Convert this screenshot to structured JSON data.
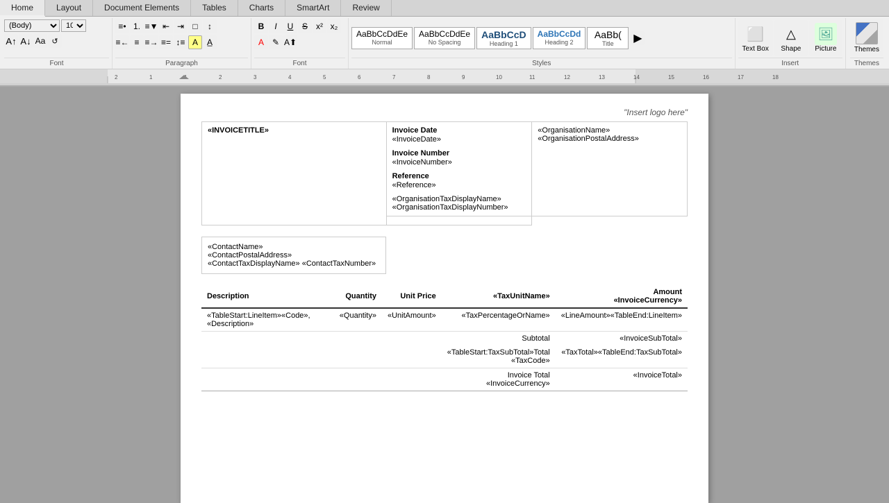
{
  "tabs": [
    {
      "label": "Home",
      "active": true
    },
    {
      "label": "Layout"
    },
    {
      "label": "Document Elements"
    },
    {
      "label": "Tables"
    },
    {
      "label": "Charts"
    },
    {
      "label": "SmartArt"
    },
    {
      "label": "Review"
    }
  ],
  "ribbon": {
    "font_group_label": "Font",
    "paragraph_group_label": "Paragraph",
    "styles_group_label": "Styles",
    "insert_group_label": "Insert",
    "themes_group_label": "Themes",
    "font_name": "(Body)",
    "font_size": "10",
    "styles": [
      {
        "preview_text": "AaBbCcDdEe",
        "name": "Normal"
      },
      {
        "preview_text": "AaBbCcDdEe",
        "name": "No Spacing"
      },
      {
        "preview_text": "AaBbCcD",
        "name": "Heading 1"
      },
      {
        "preview_text": "AaBbCcDd",
        "name": "Heading 2"
      },
      {
        "preview_text": "AaBb(",
        "name": "Title"
      }
    ],
    "insert_buttons": [
      {
        "label": "Text Box",
        "icon": "⬜"
      },
      {
        "label": "Shape",
        "icon": "△"
      },
      {
        "label": "Picture",
        "icon": "🖼"
      }
    ],
    "themes_label": "Themes"
  },
  "invoice": {
    "logo_placeholder": "\"Insert logo here\"",
    "title": "«INVOICETITLE»",
    "contact_name": "«ContactName»",
    "contact_address": "«ContactPostalAddress»",
    "contact_tax": "«ContactTaxDisplayName» «ContactTaxNumber»",
    "invoice_date_label": "Invoice Date",
    "invoice_date_value": "«InvoiceDate»",
    "invoice_number_label": "Invoice Number",
    "invoice_number_value": "«InvoiceNumber»",
    "reference_label": "Reference",
    "reference_value": "«Reference»",
    "org_tax_display": "«OrganisationTaxDisplayName»",
    "org_tax_number": "«OrganisationTaxDisplayNumber»",
    "org_name": "«OrganisationName»",
    "org_address": "«OrganisationPostalAddress»",
    "table_headers": {
      "description": "Description",
      "quantity": "Quantity",
      "unit_price": "Unit Price",
      "tax_unit": "«TaxUnitName»",
      "amount": "Amount"
    },
    "currency_placeholder": "«InvoiceCurrency»",
    "line_item": {
      "description": "«TableStart:LineItem»«Code», «Description»",
      "quantity": "«Quantity»",
      "unit_amount": "«UnitAmount»",
      "tax_percent": "«TaxPercentageOrName»",
      "line_amount": "«LineAmount»«TableEnd:LineItem»"
    },
    "subtotal_label": "Subtotal",
    "subtotal_value": "«InvoiceSubTotal»",
    "tax_row": {
      "left": "«TableStart:TaxSubTotal»Total «TaxCode»",
      "tax_total": "«TaxTotal»",
      "right": "«TableEnd:TaxSubTotal»"
    },
    "invoice_total_label": "Invoice Total «InvoiceCurrency»",
    "invoice_total_value": "«InvoiceTotal»"
  }
}
